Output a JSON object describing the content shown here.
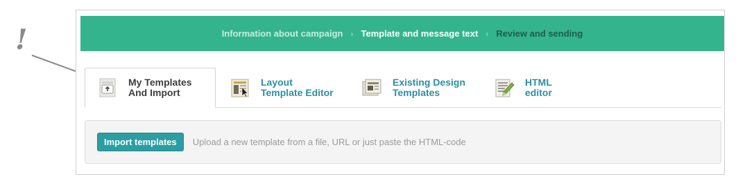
{
  "annotation": {
    "mark": "!"
  },
  "steps": [
    {
      "label": "Information about campaign",
      "state": "done"
    },
    {
      "label": "Template and message text",
      "state": "active"
    },
    {
      "label": "Review and sending",
      "state": "upcoming"
    }
  ],
  "step_separator": "›",
  "tabs": [
    {
      "line1": "My Templates",
      "line2": "And Import",
      "icon": "upload-template-icon",
      "active": true
    },
    {
      "line1": "Layout",
      "line2": "Template Editor",
      "icon": "layout-editor-icon",
      "active": false
    },
    {
      "line1": "Existing Design",
      "line2": "Templates",
      "icon": "design-templates-icon",
      "active": false
    },
    {
      "line1": "HTML",
      "line2": "editor",
      "icon": "html-editor-icon",
      "active": false
    }
  ],
  "import_panel": {
    "button_label": "Import templates",
    "hint": "Upload a new template from a file, URL or just paste the HTML-code"
  },
  "colors": {
    "header_green": "#33b48c",
    "link_teal": "#2a8fa3",
    "button_teal": "#2b9ea3"
  }
}
